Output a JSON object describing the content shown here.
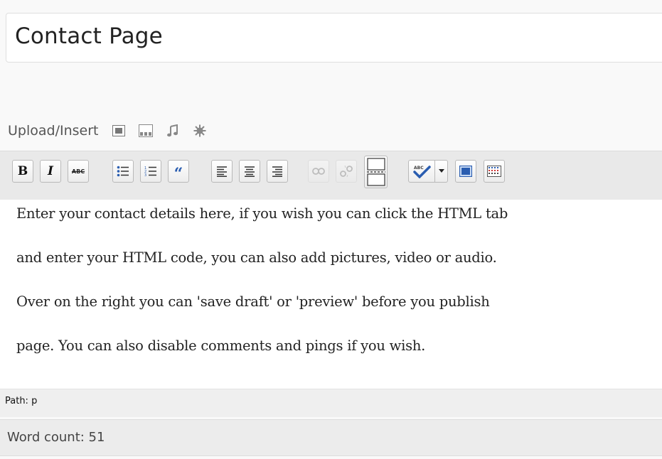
{
  "post": {
    "title": "Contact Page"
  },
  "media_bar": {
    "label": "Upload/Insert",
    "icons": [
      "image-icon",
      "video-icon",
      "audio-icon",
      "media-icon"
    ]
  },
  "toolbar": {
    "bold_label": "B",
    "italic_label": "I",
    "strikethrough_label": "ABC",
    "blockquote_label": "“",
    "buttons": [
      "bold",
      "italic",
      "strikethrough",
      "bullet-list",
      "numbered-list",
      "blockquote",
      "align-left",
      "align-center",
      "align-right",
      "insert-link",
      "unlink",
      "insert-more",
      "spellcheck",
      "fullscreen",
      "kitchen-sink"
    ],
    "disabled": [
      "insert-link",
      "unlink"
    ]
  },
  "editor": {
    "paragraphs": [
      "Enter your contact details here, if you wish you can click the HTML tab",
      "and enter your HTML code, you can also add pictures, video or audio.",
      "Over on the right you can 'save draft' or 'preview'  before you publish",
      "page.  You can also disable comments and pings if you wish."
    ]
  },
  "status": {
    "path_text": "Path: p",
    "word_count_text": "Word count: 51"
  },
  "colors": {
    "accent_blue": "#2a5db0",
    "toolbar_bg": "#e9e9e9",
    "editor_bg": "#ffffff"
  }
}
